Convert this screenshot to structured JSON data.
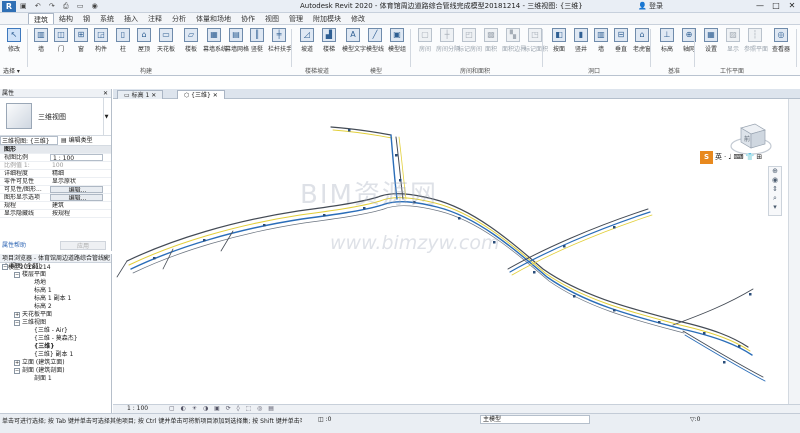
{
  "titlebar": {
    "app_icon": "R",
    "title": "Autodesk Revit 2020 - 体育馆周边道路综合管线完成模型20181214 - 三维视图: {三维}",
    "signin": "登录",
    "window_buttons": [
      "—",
      "□",
      "✕"
    ]
  },
  "tabs": [
    "建筑",
    "结构",
    "钢",
    "系统",
    "插入",
    "注释",
    "分析",
    "体量和场地",
    "协作",
    "视图",
    "管理",
    "附加模块",
    "修改"
  ],
  "active_tab": "建筑",
  "ribbon": {
    "buttons": [
      {
        "label": "修改",
        "icon": "cursor-icon",
        "glyph": "↖"
      },
      {
        "label": "墙",
        "icon": "wall-icon",
        "glyph": "▥"
      },
      {
        "label": "门",
        "icon": "door-icon",
        "glyph": "◫"
      },
      {
        "label": "窗",
        "icon": "window-icon",
        "glyph": "⊞"
      },
      {
        "label": "构件",
        "icon": "component-icon",
        "glyph": "◲"
      },
      {
        "label": "柱",
        "icon": "column-icon",
        "glyph": "▯"
      },
      {
        "label": "屋顶",
        "icon": "roof-icon",
        "glyph": "⌂"
      },
      {
        "label": "天花板",
        "icon": "ceiling-icon",
        "glyph": "▭"
      },
      {
        "label": "楼板",
        "icon": "floor-icon",
        "glyph": "▱"
      },
      {
        "label": "幕墙系统",
        "icon": "curtain-system-icon",
        "glyph": "▦"
      },
      {
        "label": "幕墙网格",
        "icon": "curtain-grid-icon",
        "glyph": "▤"
      },
      {
        "label": "竖梃",
        "icon": "mullion-icon",
        "glyph": "║"
      },
      {
        "label": "栏杆扶手",
        "icon": "railing-icon",
        "glyph": "╪"
      },
      {
        "label": "坡道",
        "icon": "ramp-icon",
        "glyph": "◿"
      },
      {
        "label": "楼梯",
        "icon": "stair-icon",
        "glyph": "▟"
      },
      {
        "label": "模型文字",
        "icon": "model-text-icon",
        "glyph": "A"
      },
      {
        "label": "模型线",
        "icon": "model-line-icon",
        "glyph": "╱"
      },
      {
        "label": "模型组",
        "icon": "model-group-icon",
        "glyph": "▣"
      },
      {
        "label": "房间",
        "icon": "room-icon",
        "glyph": "▢"
      },
      {
        "label": "房间分隔",
        "icon": "room-separator-icon",
        "glyph": "┼"
      },
      {
        "label": "标记房间",
        "icon": "tag-room-icon",
        "glyph": "◰"
      },
      {
        "label": "面积",
        "icon": "area-icon",
        "glyph": "▩"
      },
      {
        "label": "面积边界",
        "icon": "area-boundary-icon",
        "glyph": "▚"
      },
      {
        "label": "标记面积",
        "icon": "tag-area-icon",
        "glyph": "◳"
      },
      {
        "label": "按面",
        "icon": "by-face-icon",
        "glyph": "◧"
      },
      {
        "label": "竖井",
        "icon": "shaft-icon",
        "glyph": "▮"
      },
      {
        "label": "墙",
        "icon": "wall-opening-icon",
        "glyph": "▥"
      },
      {
        "label": "垂直",
        "icon": "vertical-opening-icon",
        "glyph": "⊟"
      },
      {
        "label": "老虎窗",
        "icon": "dormer-icon",
        "glyph": "⌂"
      },
      {
        "label": "标高",
        "icon": "level-icon",
        "glyph": "⊥"
      },
      {
        "label": "轴网",
        "icon": "grid-icon",
        "glyph": "⊕"
      },
      {
        "label": "设置",
        "icon": "set-workplane-icon",
        "glyph": "▦"
      },
      {
        "label": "显示",
        "icon": "show-workplane-icon",
        "glyph": "▨"
      },
      {
        "label": "参照平面",
        "icon": "ref-plane-icon",
        "glyph": "┆"
      },
      {
        "label": "查看器",
        "icon": "viewer-icon",
        "glyph": "◎"
      }
    ],
    "panels": [
      "选择",
      "构建",
      "楼梯坡道",
      "模型",
      "房间和面积",
      "洞口",
      "基准",
      "工作平面"
    ]
  },
  "properties": {
    "title": "属性",
    "close": "✕",
    "type_name": "三维视图",
    "view_selector": "三维视图: {三维}",
    "edit_type": "编辑类型",
    "rows": [
      {
        "k": "图形",
        "v": "",
        "head": true
      },
      {
        "k": "视图比例",
        "v": "1 : 100",
        "style": "box"
      },
      {
        "k": "比例值 1:",
        "v": "100",
        "grey": true
      },
      {
        "k": "详细程度",
        "v": "精细"
      },
      {
        "k": "零件可见性",
        "v": "显示原状"
      },
      {
        "k": "可见性/图形...",
        "v": "编辑...",
        "style": "btn"
      },
      {
        "k": "图形显示选项",
        "v": "编辑...",
        "style": "btn"
      },
      {
        "k": "规程",
        "v": "建筑"
      },
      {
        "k": "显示隐藏线",
        "v": "按规程"
      }
    ],
    "help": "属性帮助",
    "apply": "应用"
  },
  "browser": {
    "title": "项目浏览器 - 体育馆周边道路综合管线完成模型20181214",
    "close": "✕",
    "nodes": [
      {
        "t": "视图 (全部)",
        "d": 0,
        "tg": "−"
      },
      {
        "t": "楼层平面",
        "d": 1,
        "tg": "−"
      },
      {
        "t": "场地",
        "d": 2
      },
      {
        "t": "标高 1",
        "d": 2
      },
      {
        "t": "标高 1 副本 1",
        "d": 2
      },
      {
        "t": "标高 2",
        "d": 2
      },
      {
        "t": "天花板平面",
        "d": 1,
        "tg": "+"
      },
      {
        "t": "三维视图",
        "d": 1,
        "tg": "−"
      },
      {
        "t": "{三维 - Air}",
        "d": 2
      },
      {
        "t": "{三维 - 莫森杰}",
        "d": 2
      },
      {
        "t": "{三维}",
        "d": 2,
        "sel": true
      },
      {
        "t": "{三维} 副本 1",
        "d": 2
      },
      {
        "t": "立面 (建筑立面)",
        "d": 1,
        "tg": "+"
      },
      {
        "t": "剖面 (建筑剖面)",
        "d": 1,
        "tg": "−"
      },
      {
        "t": "剖面 1",
        "d": 2
      }
    ]
  },
  "view_tabs": [
    {
      "label": "标高 1",
      "active": false
    },
    {
      "label": "{三维}",
      "active": true
    }
  ],
  "viewcube": {
    "face": "前"
  },
  "navbar": [
    "⊕",
    "◉",
    "⇕",
    "⌕",
    "▾"
  ],
  "ime": {
    "logo": "S",
    "items": [
      "英",
      "·",
      "♩",
      "⌨",
      "👕",
      "⊞"
    ]
  },
  "watermark": {
    "line1": "BIM资源网",
    "line2": "www.bimzyw.com"
  },
  "view_control": {
    "scale": "1 : 100",
    "icons": "▢ ◐ ☀ ◑ ▣ ⟳ ◊ ⬚ ◎ ▤"
  },
  "status": {
    "message": "单击可进行选择; 按 Tab 键并单击可选择其他项目; 按 Ctrl 键并单击可将新项目添加到选择集; 按 Shift 键并单击可",
    "workset": ":0",
    "model": "主模型",
    "filter": "▽:0"
  },
  "colors": {
    "pipe_blue": "#2a6db8",
    "pipe_yellow": "#e2cf3a",
    "pipe_dark": "#444b55",
    "accent": "#2c64b4"
  }
}
